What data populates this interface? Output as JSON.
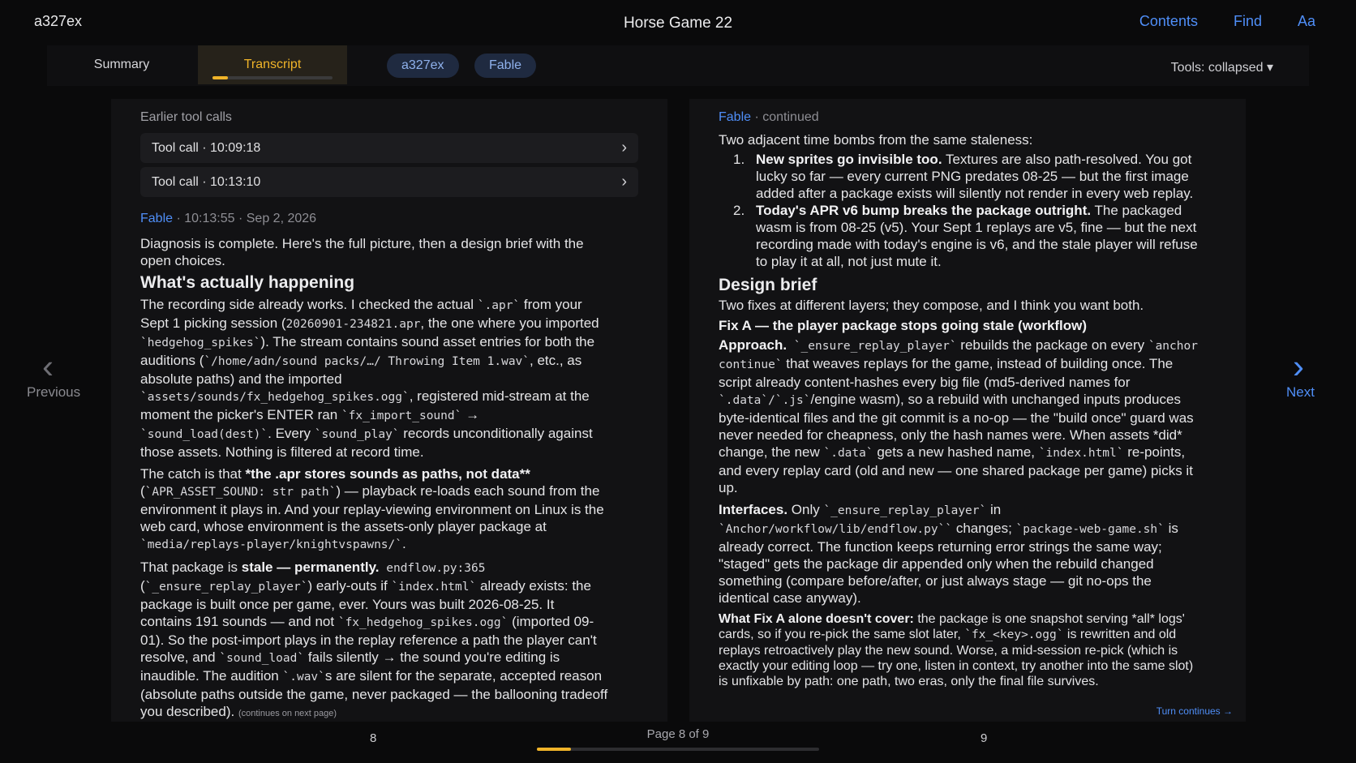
{
  "app": {
    "name": "a327ex",
    "title": "Horse Game 22"
  },
  "top_links": [
    "Contents",
    "Find",
    "Aa"
  ],
  "tabs": {
    "summary": "Summary",
    "transcript": "Transcript",
    "progress": 0.13
  },
  "chips": [
    "a327ex",
    "Fable"
  ],
  "tools_toggle": "Tools: collapsed ▾",
  "left": {
    "earlier_label": "Earlier tool calls",
    "tool_calls": [
      {
        "label": "Tool call · 10:09:18"
      },
      {
        "label": "Tool call · 10:13:10"
      }
    ],
    "speaker": "Fable",
    "meta": "· 10:13:55 · Sep 2, 2026",
    "intro": "Diagnosis is complete. Here's the full picture, then a design brief with the open choices.",
    "heading": "What's actually happening",
    "p1": {
      "a": "The recording side already works. I checked the actual ",
      "c1": "`.apr`",
      "b": " from your Sept 1 picking session (",
      "c2": "20260901-234821.apr",
      "d": ", the one where you imported ",
      "c3": "`hedgehog_spikes`",
      "e": "). The stream contains sound asset entries for both the auditions (",
      "c4": "`/home/adn/sound packs/…/ Throwing Item 1.wav`",
      "f": ", etc., as absolute paths) and the imported ",
      "c5": "`assets/sounds/fx_hedgehog_spikes.ogg`",
      "g": ", registered mid-stream at the moment the picker's ENTER ran ",
      "c6": "`fx_import_sound`",
      "h": " → ",
      "c7": "`sound_load(dest)`",
      "i": ". Every ",
      "c8": "`sound_play`",
      "j": " records unconditionally against those assets. Nothing is filtered at record time."
    },
    "p2": {
      "a": "The catch is that ",
      "b": "*the .apr stores sounds as paths, not data**",
      "c": " (",
      "c1": "`APR_ASSET_SOUND: str path`",
      "d": ") — playback re-loads each sound from the environment it plays in. And your replay-viewing environment on Linux is the web card, whose environment is the assets-only player package at ",
      "c2": "`media/replays-player/knightvspawns/`",
      "e": "."
    },
    "p3": {
      "a": "That package is ",
      "b1": "stale — permanently.",
      "c1": " endflow.py:365",
      "c": " (",
      "c2": "`_ensure_replay_player`",
      "d": ") early-outs if ",
      "c3": "`index.html`",
      "e": " already exists: the package is built once per game, ever. Yours was built 2026-08-25. It contains 191 sounds — and not ",
      "c4": "`fx_hedgehog_spikes.ogg`",
      "f": " (imported 09-01). So the post-import plays in the replay reference a path the player can't resolve, and ",
      "c5": "`sound_load`",
      "g": " fails silently → the sound you're editing is inaudible. The audition ",
      "c6": "`.wav`",
      "h": "s are silent for the separate, accepted reason (absolute paths outside the game, never packaged — the ballooning tradeoff you described)."
    },
    "continues": "(continues on next page)",
    "page_number": "8"
  },
  "right": {
    "speaker": "Fable",
    "meta": "· continued",
    "lead": "Two adjacent time bombs from the same staleness:",
    "items": [
      {
        "num": "1.",
        "bold": "New sprites go invisible too.",
        "text": " Textures are also path-resolved. You got lucky so far — every current PNG predates 08-25 — but the first image added after a package exists will silently not render in every web replay."
      },
      {
        "num": "2.",
        "bold": "Today's APR v6 bump breaks the package outright.",
        "text": " The packaged wasm is from 08-25 (v5). Your Sept 1 replays are v5, fine — but the next recording made with today's engine is v6, and the stale player will refuse to play it at all, not just mute it."
      }
    ],
    "heading": "Design brief",
    "brief_lead": "Two fixes at different layers; they compose, and I think you want both.",
    "fix_a_title": "Fix A — the player package stops going stale (workflow)",
    "approach": {
      "label": "Approach.",
      "c1": " `_ensure_replay_player`",
      "a": " rebuilds the package on every ",
      "c2": "`anchor continue`",
      "b": " that weaves replays for the game, instead of building once. The script already content-hashes every big file (md5-derived names for ",
      "c3": "`.data`/`.js`",
      "c": "/engine wasm), so a rebuild with unchanged inputs produces byte-identical files and the git commit is a no-op — the \"build once\" guard was never needed for cheapness, only the hash names were. When assets *did* change, the new ",
      "c4": "`.data`",
      "d": " gets a new hashed name, ",
      "c5": "`index.html`",
      "e": " re-points, and every replay card (old and new — one shared package per game) picks it up."
    },
    "interfaces": {
      "label": "Interfaces.",
      "a": " Only ",
      "c1": "`_ensure_replay_player`",
      "b": " in ",
      "c2": "`Anchor/workflow/lib/endflow.py``",
      "c": " changes; ",
      "c3": "`package-web-game.sh`",
      "d": " is already correct. The function keeps returning error strings the same way; \"staged\" gets the package dir appended only when the rebuild changed something (compare before/after, or just always stage — git no-ops the identical case anyway)."
    },
    "what_fix": {
      "label": "What Fix A alone doesn't cover:",
      "a": " the package is one snapshot serving *all* logs' cards, so if you re-pick the same slot later, ",
      "c1": "`fx_<key>.ogg`",
      "b": " is rewritten and old replays retroactively play the new sound. Worse, a mid-session re-pick (which is exactly your editing loop — try one, listen in context, try another into the same slot) is unfixable by path: one path, two eras, only the final file survives."
    },
    "turn_continues": "Turn continues →",
    "page_number": "9"
  },
  "nav": {
    "previous": "Previous",
    "next": "Next"
  },
  "footer": {
    "page_of": "Page 8 of 9",
    "progress": 0.12
  },
  "colors": {
    "accent": "#4f8ef7",
    "highlight": "#f0b429",
    "background": "#0a0a0b",
    "panel": "#121214"
  }
}
